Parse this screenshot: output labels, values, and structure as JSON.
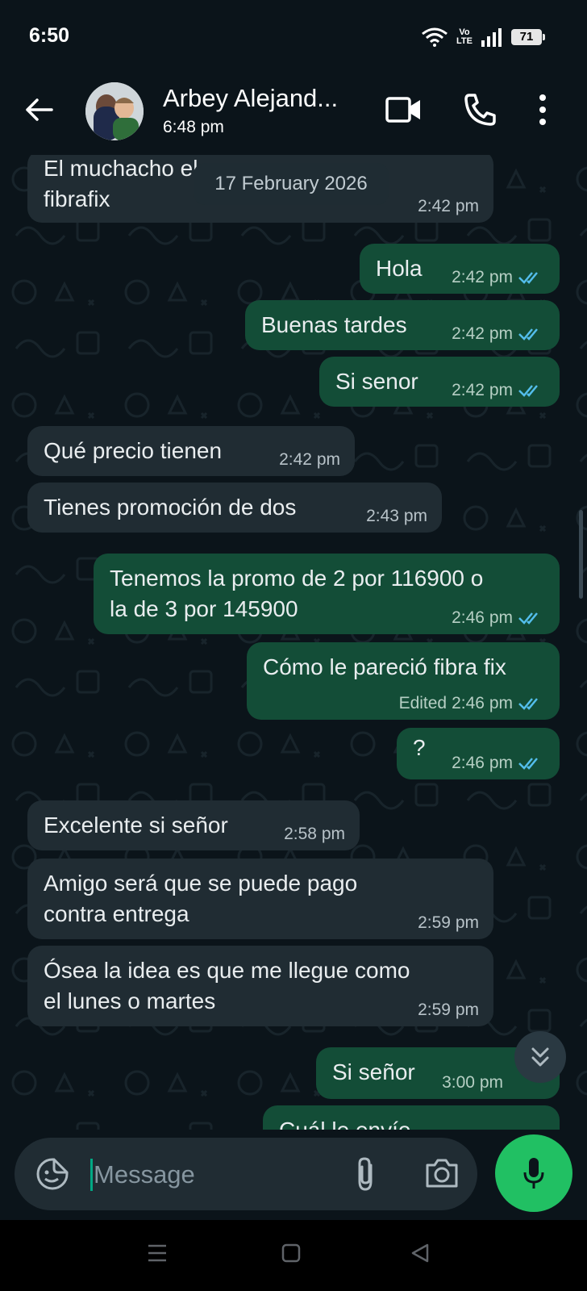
{
  "status": {
    "time": "6:50",
    "lte_top": "Vo",
    "lte_bottom": "LTE",
    "battery": "71"
  },
  "header": {
    "name": "Arbey Alejand...",
    "subtitle": "6:48 pm"
  },
  "date_chip": "17 February 2026",
  "messages": [
    {
      "dir": "in",
      "text": "El muchacho                      el\nfibrafix",
      "time": "2:42 pm"
    },
    {
      "dir": "out",
      "text": "Hola",
      "time": "2:42 pm"
    },
    {
      "dir": "out",
      "text": "Buenas tardes",
      "time": "2:42 pm"
    },
    {
      "dir": "out",
      "text": "Si senor",
      "time": "2:42 pm"
    },
    {
      "dir": "in",
      "text": "Qué precio tienen",
      "time": "2:42 pm"
    },
    {
      "dir": "in",
      "text": "Tienes promoción de dos",
      "time": "2:43 pm"
    },
    {
      "dir": "out",
      "text": "Tenemos la promo de 2 por 116900 o\nla de 3 por 145900",
      "time": "2:46 pm"
    },
    {
      "dir": "out",
      "text": "Cómo le pareció fibra fix",
      "edited": "Edited",
      "time": "2:46 pm"
    },
    {
      "dir": "out",
      "text": "?",
      "time": "2:46 pm"
    },
    {
      "dir": "in",
      "text": "Excelente si señor",
      "time": "2:58 pm"
    },
    {
      "dir": "in",
      "text": "Amigo será que se puede pago\ncontra entrega",
      "time": "2:59 pm"
    },
    {
      "dir": "in",
      "text": "Ósea la idea es que me llegue como\nel lunes o martes",
      "time": "2:59 pm"
    },
    {
      "dir": "out",
      "text": "Si señor",
      "time": "3:00 pm"
    },
    {
      "dir": "out",
      "text": "Cuál le envío",
      "time": ""
    }
  ],
  "composer": {
    "placeholder": "Message"
  },
  "colors": {
    "incoming": "#202c33",
    "outgoing": "#134d37",
    "accent": "#21c063",
    "ticks": "#53bdeb"
  },
  "icons": [
    "back-arrow-icon",
    "video-call-icon",
    "phone-icon",
    "more-vert-icon",
    "sticker-icon",
    "paperclip-icon",
    "camera-icon",
    "mic-icon",
    "double-chevron-down-icon"
  ]
}
